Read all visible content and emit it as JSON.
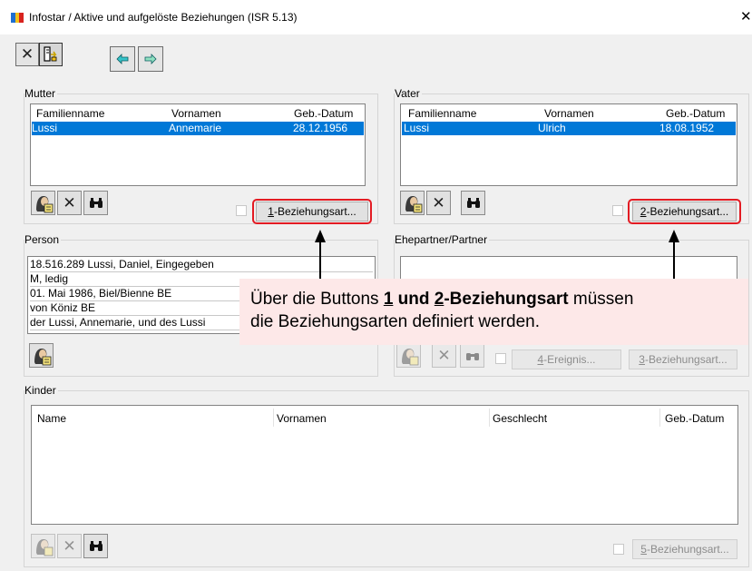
{
  "window": {
    "title": "Infostar / Aktive und aufgelöste Beziehungen (ISR 5.13)",
    "close_glyph": "✕"
  },
  "toolbar": {
    "icons": [
      "close-x-icon",
      "form-select-icon",
      "arrow-left-icon",
      "arrow-right-icon"
    ]
  },
  "mutter": {
    "label": "Mutter",
    "columns": [
      "Familienname",
      "Vornamen",
      "Geb.-Datum"
    ],
    "rows": [
      {
        "familienname": "Lussi",
        "vornamen": "Annemarie",
        "geb_datum": "28.12.1956"
      }
    ],
    "beziehungsart_button": {
      "hotkey": "1",
      "label": "-Beziehungsart..."
    }
  },
  "vater": {
    "label": "Vater",
    "columns": [
      "Familienname",
      "Vornamen",
      "Geb.-Datum"
    ],
    "rows": [
      {
        "familienname": "Lussi",
        "vornamen": "Ulrich",
        "geb_datum": "18.08.1952"
      }
    ],
    "beziehungsart_button": {
      "hotkey": "2",
      "label": "-Beziehungsart..."
    }
  },
  "person": {
    "label": "Person",
    "lines": [
      "18.516.289  Lussi, Daniel, Eingegeben",
      "M, ledig",
      "01. Mai 1986, Biel/Bienne BE",
      "von Köniz BE",
      "der Lussi, Annemarie, und des Lussi"
    ]
  },
  "partner": {
    "label": "Ehepartner/Partner",
    "ereignis_button": {
      "hotkey": "4",
      "label": "-Ereignis..."
    },
    "beziehungsart_button": {
      "hotkey": "3",
      "label": "-Beziehungsart..."
    }
  },
  "kinder": {
    "label": "Kinder",
    "columns": [
      "Name",
      "Vornamen",
      "Geschlecht",
      "Geb.-Datum"
    ],
    "beziehungsart_button": {
      "hotkey": "5",
      "label": "-Beziehungsart..."
    }
  },
  "callout": {
    "line1_prefix": "Über die Buttons ",
    "line1_b1": "1",
    "line1_b2": " und ",
    "line1_b3": "2",
    "line1_b4": "-Beziehungsart",
    "line1_suffix": " müssen",
    "line2": "die Beziehungsarten definiert werden."
  },
  "colors": {
    "selection": "#0078d7",
    "highlight": "#e31b23",
    "callout_bg": "#fde8e8"
  }
}
